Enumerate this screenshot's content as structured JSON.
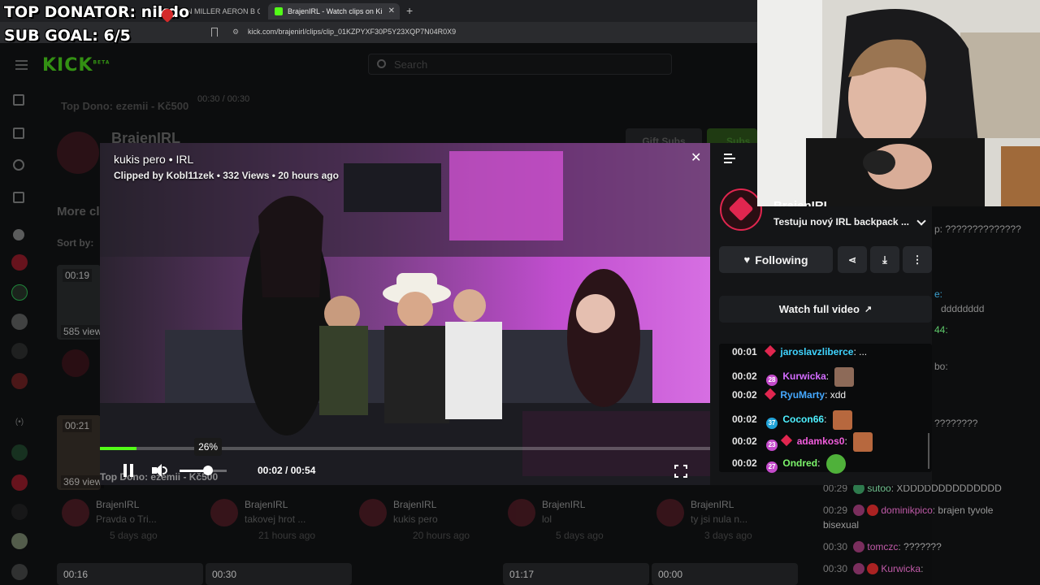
{
  "overlay": {
    "top_donator": "TOP DONATOR: nikdo",
    "sub_goal": "SUB GOAL: 6/5"
  },
  "browser": {
    "tabs": [
      {
        "label": "ERMAN MILLER AERON B Graphite"
      },
      {
        "label": "BrajenIRL - Watch clips on Ki"
      }
    ],
    "url": "kick.com/brajenirl/clips/clip_01KZPYXF30P5Y23XQP7N04R0X9"
  },
  "kick": {
    "logo": "KICK",
    "logo_sup": "BETA",
    "search_placeholder": "Search",
    "top_dono_bg": "Top Dono: ezemii - Kč500",
    "time_bg": "00:30 / 00:30",
    "channel_name_bg": "BraienIRL",
    "more_clips": "More cl",
    "sort_by": "Sort by:",
    "gift_subs": "Gift Subs",
    "subscribe": "Subs",
    "views_bg": [
      "585 view",
      "369 view"
    ],
    "durations_left": [
      "00:19",
      "00:21"
    ],
    "cards": [
      {
        "channel": "BrajenIRL",
        "title": "Pravda o Tri...",
        "age": "5 days ago"
      },
      {
        "channel": "BrajenIRL",
        "title": "takovej hrot ...",
        "age": "21 hours ago"
      },
      {
        "channel": "BrajenIRL",
        "title": "kukis pero",
        "age": "20 hours ago"
      },
      {
        "channel": "BrajenIRL",
        "title": "lol",
        "age": "5 days ago"
      },
      {
        "channel": "BrajenIRL",
        "title": "ty jsi nula n...",
        "age": "3 days ago"
      }
    ],
    "bottom_durations": [
      "00:16",
      "00:30",
      "01:17",
      "00:00"
    ]
  },
  "modal": {
    "title": "kukis pero • IRL",
    "meta": "Clipped by Kobl11zek • 332 Views • 20 hours ago",
    "volume_tooltip": "26%",
    "volume_level": 0.26,
    "progress": 0.06,
    "time": "00:02 / 00:54",
    "video_overlay_text": "Top Dono: ezemii - Kč500",
    "side": {
      "channel": "BrajenIRL",
      "stream_title": "Testuju nový IRL backpack ...",
      "following_label": "Following",
      "watch_full_label": "Watch full video"
    },
    "chat": [
      {
        "time": "00:01",
        "user": "jaroslavzliberce",
        "user_color": "#3fd4ff",
        "badge": "",
        "msg": ": ..."
      },
      {
        "time": "00:02",
        "user": "Kurwicka",
        "user_color": "#d36cff",
        "badge": "28",
        "badge_color": "#c44acb",
        "msg": ":"
      },
      {
        "time": "00:02",
        "user": "RyuMarty",
        "user_color": "#45a8ff",
        "badge": "",
        "msg": ": xdd"
      },
      {
        "time": "00:02",
        "user": "Cocon66",
        "user_color": "#4df0ff",
        "badge": "37",
        "badge_color": "#21a3d8",
        "msg": ":"
      },
      {
        "time": "00:02",
        "user": "adamkos0",
        "user_color": "#f25ddd",
        "badge": "23",
        "badge_color": "#c44acb",
        "msg": ":"
      },
      {
        "time": "00:02",
        "user": "Ondred",
        "user_color": "#7cf56b",
        "badge": "27",
        "badge_color": "#c44acb",
        "msg": ":"
      }
    ]
  },
  "right_chat": [
    {
      "time": "",
      "user": "",
      "msg": "p: ??????????????"
    },
    {
      "time": "",
      "user": "",
      "msg": "e:"
    },
    {
      "time": "",
      "user": "",
      "msg": "dddddddd"
    },
    {
      "time": "",
      "user": "",
      "msg": "44:"
    },
    {
      "time": "",
      "user": "",
      "msg": "bo:"
    },
    {
      "time": "",
      "user": "",
      "msg": "????????"
    },
    {
      "time": "00:29",
      "user": "sutoo",
      "msg": ": XDDDDDDDDDDDDDD"
    },
    {
      "time": "00:29",
      "user": "dominikpico",
      "msg": ": brajen tyvole"
    },
    {
      "time": "",
      "user": "",
      "msg": "bisexual"
    },
    {
      "time": "00:30",
      "user": "tomczc",
      "msg": ": ???????"
    },
    {
      "time": "00:30",
      "user": "Kurwicka",
      "msg": ":"
    }
  ],
  "colors": {
    "kick_green": "#53fc18",
    "progress_green": "#53fc18",
    "accent_red": "#e0264f"
  }
}
